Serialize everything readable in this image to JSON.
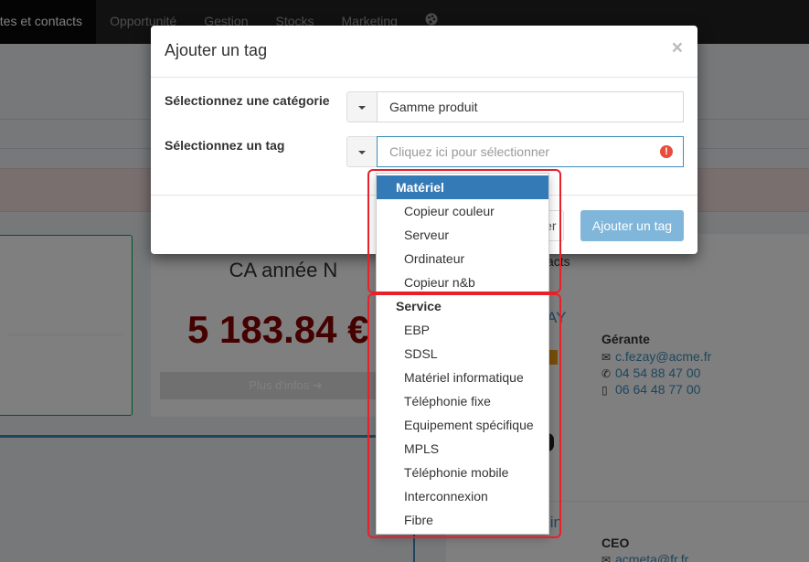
{
  "nav": {
    "items": [
      "ptes et contacts",
      "Opportunité",
      "Gestion",
      "Stocks",
      "Marketing"
    ],
    "settings_icon": "palette-icon"
  },
  "background": {
    "ca_title": "CA année N",
    "ca_value": "5 183.84 €",
    "more_info": "Plus d'infos",
    "right_title": "acts",
    "contact1": {
      "name": "AY",
      "role": "Gérante",
      "email": "c.fezay@acme.fr",
      "phone": "04 54 88 47 00",
      "mobile": "06 64 48 77 00"
    },
    "contact2": {
      "name": "lin",
      "role": "CEO",
      "email": "acmeta@fr.fr"
    }
  },
  "modal": {
    "title": "Ajouter un tag",
    "close": "×",
    "category_label": "Sélectionnez une catégorie",
    "category_value": "Gamme produit",
    "tag_label": "Sélectionnez un tag",
    "tag_placeholder": "Cliquez ici pour sélectionner",
    "error_icon": "!",
    "cancel_label": "ler",
    "add_label": "Ajouter un tag"
  },
  "dropdown": {
    "groups": [
      {
        "label": "Matériel",
        "items": [
          "Copieur couleur",
          "Serveur",
          "Ordinateur",
          "Copieur n&b"
        ]
      },
      {
        "label": "Service",
        "items": [
          "EBP",
          "SDSL",
          "Matériel informatique",
          "Téléphonie fixe",
          "Equipement spécifique",
          "MPLS",
          "Téléphonie mobile",
          "Interconnexion",
          "Fibre"
        ]
      }
    ],
    "highlight_color": "#337ab7",
    "annotation_color": "#e8202a"
  }
}
